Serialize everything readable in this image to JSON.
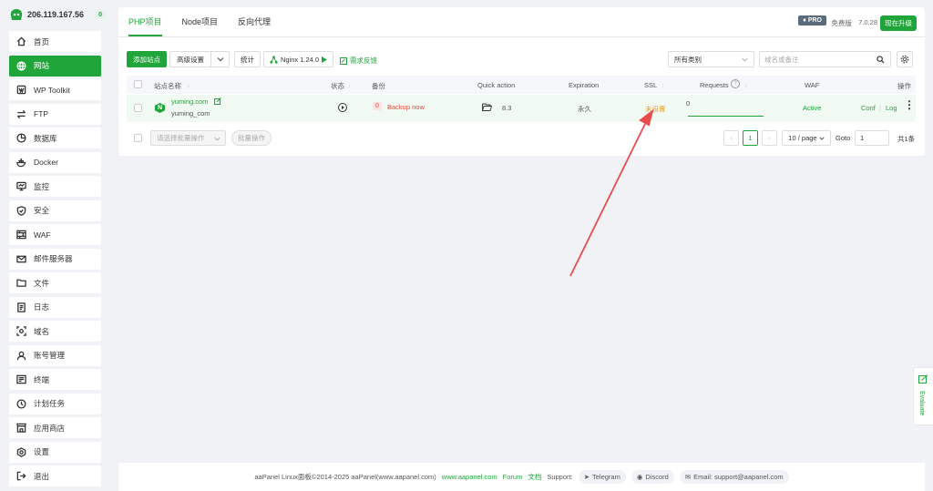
{
  "server": {
    "ip": "206.119.167.56",
    "badge": "0"
  },
  "sidebar": {
    "items": [
      {
        "label": "首页",
        "icon": "home-icon"
      },
      {
        "label": "网站",
        "icon": "globe-icon"
      },
      {
        "label": "WP Toolkit",
        "icon": "wordpress-icon"
      },
      {
        "label": "FTP",
        "icon": "transfer-icon"
      },
      {
        "label": "数据库",
        "icon": "database-icon"
      },
      {
        "label": "Docker",
        "icon": "docker-icon"
      },
      {
        "label": "监控",
        "icon": "monitor-icon"
      },
      {
        "label": "安全",
        "icon": "shield-icon"
      },
      {
        "label": "WAF",
        "icon": "waf-icon"
      },
      {
        "label": "邮件服务器",
        "icon": "mail-icon"
      },
      {
        "label": "文件",
        "icon": "folder-icon"
      },
      {
        "label": "日志",
        "icon": "log-icon"
      },
      {
        "label": "域名",
        "icon": "domain-icon"
      },
      {
        "label": "账号管理",
        "icon": "user-icon"
      },
      {
        "label": "终端",
        "icon": "terminal-icon"
      },
      {
        "label": "计划任务",
        "icon": "clock-icon"
      },
      {
        "label": "应用商店",
        "icon": "store-icon"
      },
      {
        "label": "设置",
        "icon": "gear-icon"
      },
      {
        "label": "退出",
        "icon": "logout-icon"
      }
    ]
  },
  "tabs": [
    "PHP项目",
    "Node项目",
    "反向代理"
  ],
  "header": {
    "pro": "PRO",
    "free_edition": "免费版",
    "version": "7.0.28",
    "upgrade": "现在升级"
  },
  "toolbar": {
    "add_site": "添加站点",
    "advanced": "高级设置",
    "stats": "统计",
    "nginx": "Nginx 1.24.0",
    "feedback": "需求反馈",
    "category": "所有类别",
    "search_placeholder": "域名或备注"
  },
  "table": {
    "columns": [
      "站点名称",
      "状态",
      "备份",
      "Quick action",
      "Expiration",
      "SSL",
      "Requests",
      "WAF",
      "操作"
    ],
    "rows": [
      {
        "domain": "yuming.com",
        "note": "yuming_com",
        "backup_count": "0",
        "backup_label": "Backup now",
        "php": "8.3",
        "expiration": "永久",
        "ssl": "未设置",
        "requests": "0",
        "waf": "Active",
        "conf": "Conf",
        "log": "Log"
      }
    ]
  },
  "batch": {
    "select_placeholder": "请选择批量操作",
    "button": "批量操作"
  },
  "pagination": {
    "current": "1",
    "per_page": "10 / page",
    "goto_label": "Goto",
    "goto_value": "1",
    "total": "共1条"
  },
  "footer": {
    "copyright": "aaPanel Linux面板©2014-2025 aaPanel(www.aapanel.com)",
    "site": "www.aapanel.com",
    "forum": "Forum",
    "docs": "文档",
    "support": "Support:",
    "telegram": "Telegram",
    "discord": "Discord",
    "email": "Email: support@aapanel.com"
  },
  "evaluate": "Evaluate",
  "colors": {
    "accent": "#20a53a",
    "warning": "#f0a020",
    "danger": "#e84c3d",
    "arrow": "#e84c4c"
  }
}
